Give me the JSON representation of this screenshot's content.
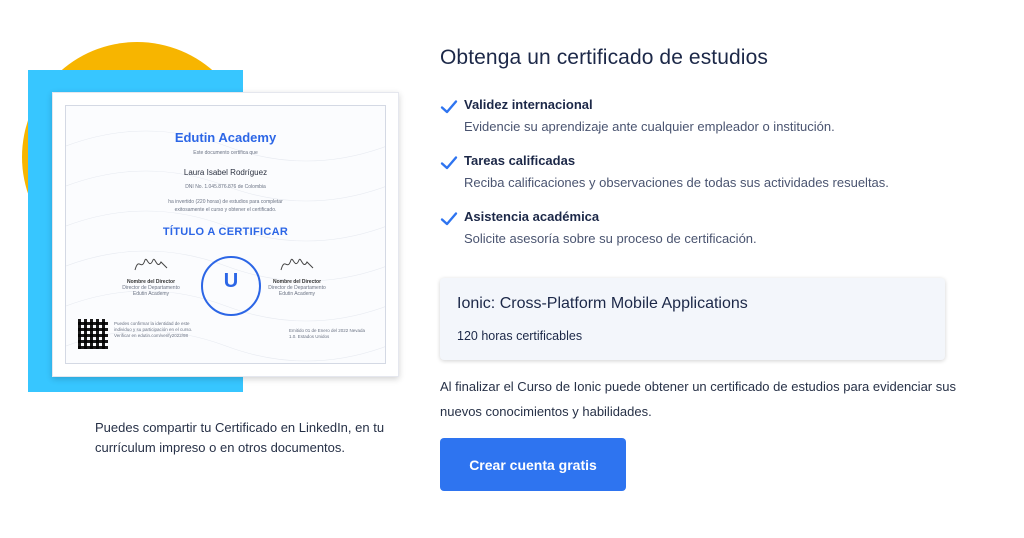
{
  "certificate_preview": {
    "brand": "Edutin Academy",
    "certifies_text": "Este documento certifica que",
    "student_name": "Laura Isabel Rodríguez",
    "id_text": "DNI No. 1.045.876.876 de Colombia",
    "statement_line1": "ha invertido (220 horas) de estudios para completar",
    "statement_line2": "exitosamente el curso y obtener el certificado.",
    "title_placeholder": "TÍTULO A CERTIFICAR",
    "signature_left": {
      "name": "Nombre del Director",
      "role1": "Director de Departamento",
      "role2": "Edutin Academy"
    },
    "signature_right": {
      "name": "Nombre del Director",
      "role1": "Director de Departamento",
      "role2": "Edutin Academy"
    },
    "seal_letter": "U",
    "qr_text": "Puedes confirmar la identidad de este individuo y su participación en el curso. Verificar en edutin.com/verify2022/98",
    "date_text": "Emitido 01 de Enero del 2022 Nevada 1.0. Estados Unidos"
  },
  "left_caption": "Puedes compartir tu Certificado en LinkedIn, en tu currículum impreso o en otros documentos.",
  "heading": "Obtenga un certificado de estudios",
  "features": [
    {
      "title": "Validez internacional",
      "description": "Evidencie su aprendizaje ante cualquier empleador o institución."
    },
    {
      "title": "Tareas calificadas",
      "description": "Reciba calificaciones y observaciones de todas sus actividades resueltas."
    },
    {
      "title": "Asistencia académica",
      "description": "Solicite asesoría sobre su proceso de certificación."
    }
  ],
  "course": {
    "title": "Ionic: Cross-Platform Mobile Applications",
    "hours": "120 horas certificables"
  },
  "paragraph": "Al finalizar el Curso de Ionic puede obtener un certificado de estudios para evidenciar sus nuevos conocimientos y habilidades.",
  "cta_label": "Crear cuenta gratis",
  "colors": {
    "accent": "#2e74f0",
    "yellow": "#f7b500",
    "light_blue": "#37c6ff",
    "heading": "#1c2848"
  },
  "icons": [
    "check-icon"
  ]
}
